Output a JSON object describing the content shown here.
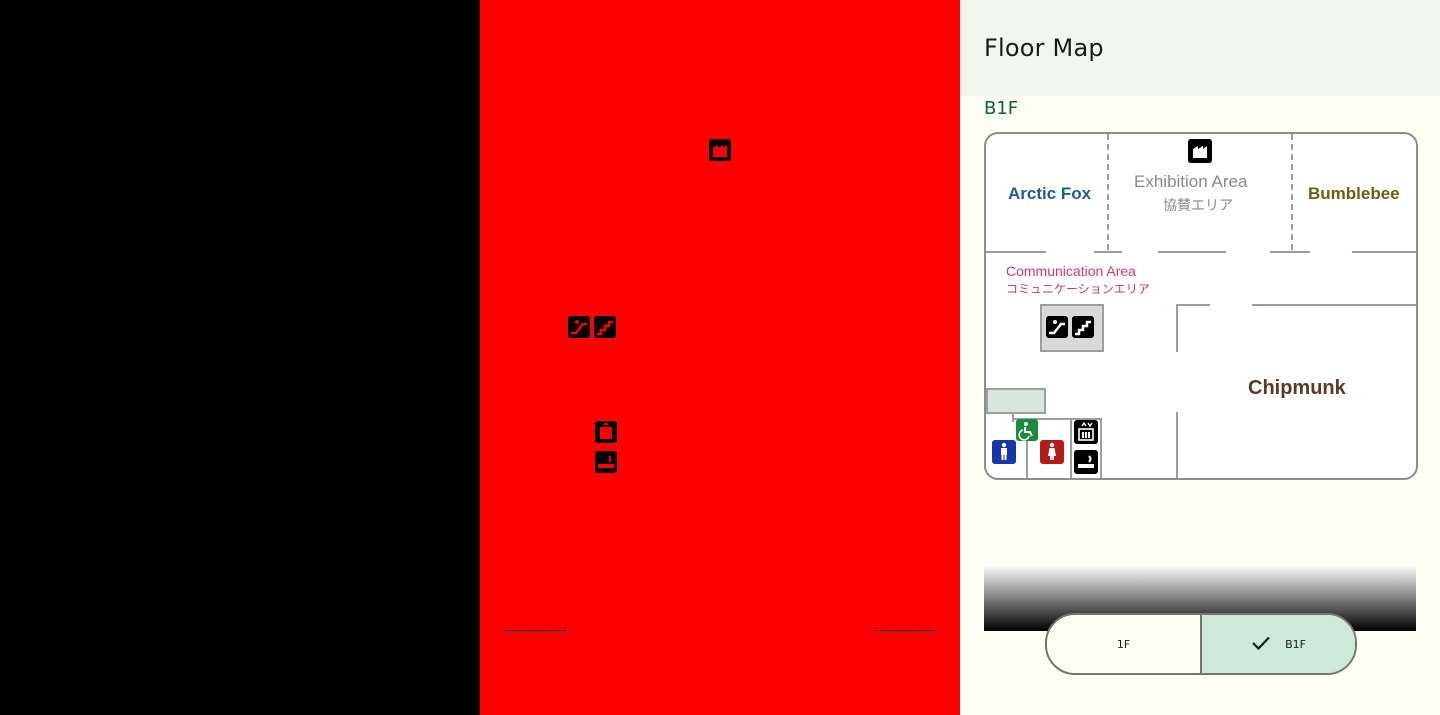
{
  "header": {
    "title": "Floor Map"
  },
  "floor": {
    "label": "B1F"
  },
  "map": {
    "arctic_fox": "Arctic Fox",
    "exhibition_en": "Exhibition Area",
    "exhibition_jp": "協賛エリア",
    "bumblebee": "Bumblebee",
    "communication_en": "Communication Area",
    "communication_jp": "コミュニケーションエリア",
    "chipmunk": "Chipmunk"
  },
  "colors": {
    "arctic_fox": "#1f5c96",
    "bumblebee": "#6e5e12",
    "exhibition": "#8a8a8a",
    "communication": "#d6337a",
    "chipmunk": "#5a3a2a",
    "accent_green": "#0e6137",
    "selected_bg": "#cde9d9"
  },
  "floor_switch": {
    "option_1f": "1F",
    "option_b1f": "B1F",
    "selected": "B1F"
  }
}
